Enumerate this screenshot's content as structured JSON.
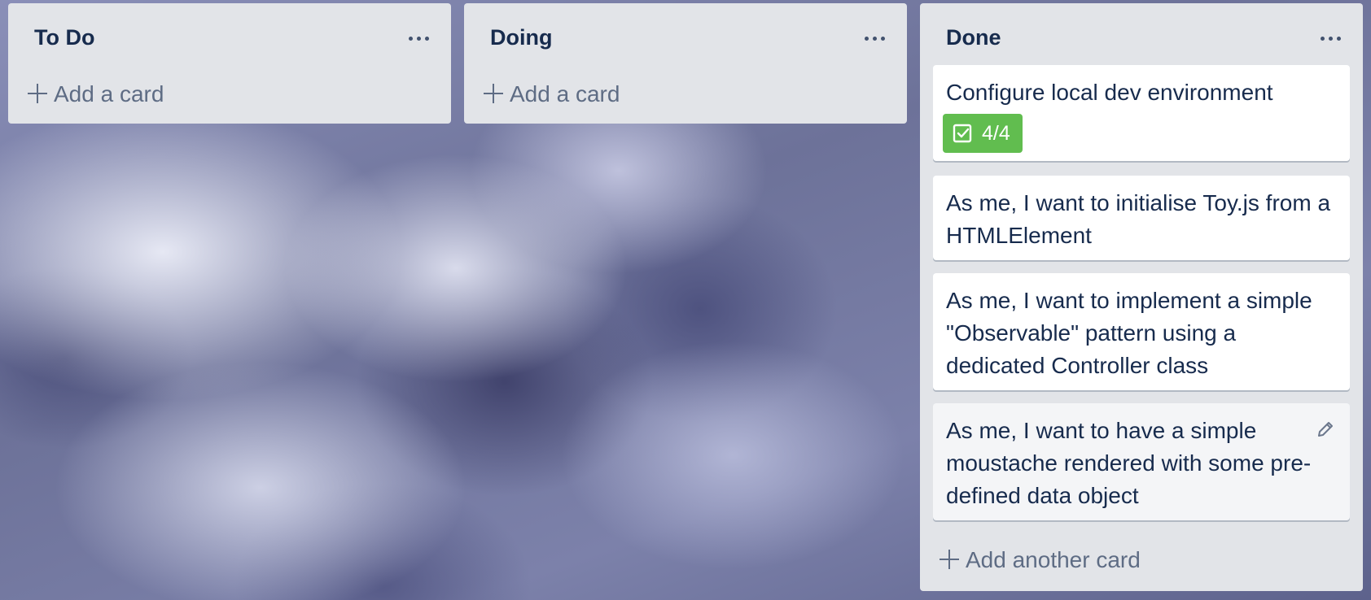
{
  "board": {
    "lists": [
      {
        "title": "To Do",
        "add_card_label": "Add a card",
        "menu_icon": "ellipsis-icon"
      },
      {
        "title": "Doing",
        "add_card_label": "Add a card",
        "menu_icon": "ellipsis-icon"
      },
      {
        "title": "Done",
        "menu_icon": "ellipsis-icon",
        "cards": [
          {
            "text": "Configure local dev environment",
            "checklist_badge": "4/4",
            "badge_icon": "checkbox-icon",
            "badge_color": "#61bd4f"
          },
          {
            "text": "As me, I want to initialise Toy.js from a HTMLElement"
          },
          {
            "text": "As me, I want to implement a simple \"Observable\" pattern using a dedicated Controller class"
          },
          {
            "text": "As me, I want to have a simple moustache rendered with some pre-defined data object",
            "edit_icon": "pencil-icon"
          }
        ],
        "add_another_label": "Add another card"
      }
    ]
  },
  "colors": {
    "list_bg": "#e2e4e8",
    "title_text": "#172b4d",
    "muted_text": "#5e6c84",
    "card_bg": "#ffffff"
  }
}
